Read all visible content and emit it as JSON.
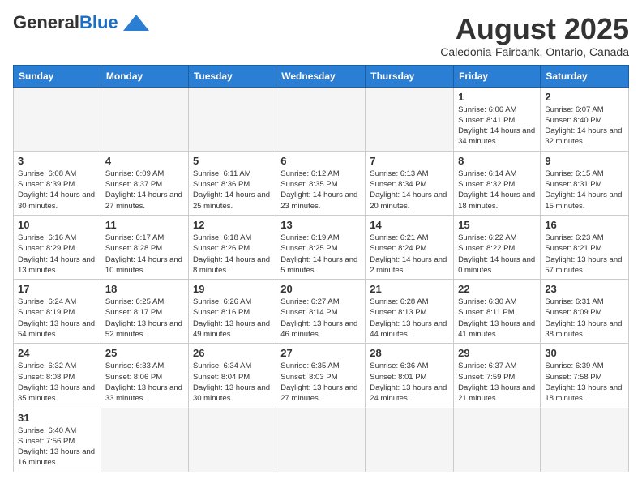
{
  "logo": {
    "general": "General",
    "blue": "Blue"
  },
  "title": "August 2025",
  "subtitle": "Caledonia-Fairbank, Ontario, Canada",
  "days_of_week": [
    "Sunday",
    "Monday",
    "Tuesday",
    "Wednesday",
    "Thursday",
    "Friday",
    "Saturday"
  ],
  "weeks": [
    [
      {
        "day": "",
        "info": ""
      },
      {
        "day": "",
        "info": ""
      },
      {
        "day": "",
        "info": ""
      },
      {
        "day": "",
        "info": ""
      },
      {
        "day": "",
        "info": ""
      },
      {
        "day": "1",
        "info": "Sunrise: 6:06 AM\nSunset: 8:41 PM\nDaylight: 14 hours and 34 minutes."
      },
      {
        "day": "2",
        "info": "Sunrise: 6:07 AM\nSunset: 8:40 PM\nDaylight: 14 hours and 32 minutes."
      }
    ],
    [
      {
        "day": "3",
        "info": "Sunrise: 6:08 AM\nSunset: 8:39 PM\nDaylight: 14 hours and 30 minutes."
      },
      {
        "day": "4",
        "info": "Sunrise: 6:09 AM\nSunset: 8:37 PM\nDaylight: 14 hours and 27 minutes."
      },
      {
        "day": "5",
        "info": "Sunrise: 6:11 AM\nSunset: 8:36 PM\nDaylight: 14 hours and 25 minutes."
      },
      {
        "day": "6",
        "info": "Sunrise: 6:12 AM\nSunset: 8:35 PM\nDaylight: 14 hours and 23 minutes."
      },
      {
        "day": "7",
        "info": "Sunrise: 6:13 AM\nSunset: 8:34 PM\nDaylight: 14 hours and 20 minutes."
      },
      {
        "day": "8",
        "info": "Sunrise: 6:14 AM\nSunset: 8:32 PM\nDaylight: 14 hours and 18 minutes."
      },
      {
        "day": "9",
        "info": "Sunrise: 6:15 AM\nSunset: 8:31 PM\nDaylight: 14 hours and 15 minutes."
      }
    ],
    [
      {
        "day": "10",
        "info": "Sunrise: 6:16 AM\nSunset: 8:29 PM\nDaylight: 14 hours and 13 minutes."
      },
      {
        "day": "11",
        "info": "Sunrise: 6:17 AM\nSunset: 8:28 PM\nDaylight: 14 hours and 10 minutes."
      },
      {
        "day": "12",
        "info": "Sunrise: 6:18 AM\nSunset: 8:26 PM\nDaylight: 14 hours and 8 minutes."
      },
      {
        "day": "13",
        "info": "Sunrise: 6:19 AM\nSunset: 8:25 PM\nDaylight: 14 hours and 5 minutes."
      },
      {
        "day": "14",
        "info": "Sunrise: 6:21 AM\nSunset: 8:24 PM\nDaylight: 14 hours and 2 minutes."
      },
      {
        "day": "15",
        "info": "Sunrise: 6:22 AM\nSunset: 8:22 PM\nDaylight: 14 hours and 0 minutes."
      },
      {
        "day": "16",
        "info": "Sunrise: 6:23 AM\nSunset: 8:21 PM\nDaylight: 13 hours and 57 minutes."
      }
    ],
    [
      {
        "day": "17",
        "info": "Sunrise: 6:24 AM\nSunset: 8:19 PM\nDaylight: 13 hours and 54 minutes."
      },
      {
        "day": "18",
        "info": "Sunrise: 6:25 AM\nSunset: 8:17 PM\nDaylight: 13 hours and 52 minutes."
      },
      {
        "day": "19",
        "info": "Sunrise: 6:26 AM\nSunset: 8:16 PM\nDaylight: 13 hours and 49 minutes."
      },
      {
        "day": "20",
        "info": "Sunrise: 6:27 AM\nSunset: 8:14 PM\nDaylight: 13 hours and 46 minutes."
      },
      {
        "day": "21",
        "info": "Sunrise: 6:28 AM\nSunset: 8:13 PM\nDaylight: 13 hours and 44 minutes."
      },
      {
        "day": "22",
        "info": "Sunrise: 6:30 AM\nSunset: 8:11 PM\nDaylight: 13 hours and 41 minutes."
      },
      {
        "day": "23",
        "info": "Sunrise: 6:31 AM\nSunset: 8:09 PM\nDaylight: 13 hours and 38 minutes."
      }
    ],
    [
      {
        "day": "24",
        "info": "Sunrise: 6:32 AM\nSunset: 8:08 PM\nDaylight: 13 hours and 35 minutes."
      },
      {
        "day": "25",
        "info": "Sunrise: 6:33 AM\nSunset: 8:06 PM\nDaylight: 13 hours and 33 minutes."
      },
      {
        "day": "26",
        "info": "Sunrise: 6:34 AM\nSunset: 8:04 PM\nDaylight: 13 hours and 30 minutes."
      },
      {
        "day": "27",
        "info": "Sunrise: 6:35 AM\nSunset: 8:03 PM\nDaylight: 13 hours and 27 minutes."
      },
      {
        "day": "28",
        "info": "Sunrise: 6:36 AM\nSunset: 8:01 PM\nDaylight: 13 hours and 24 minutes."
      },
      {
        "day": "29",
        "info": "Sunrise: 6:37 AM\nSunset: 7:59 PM\nDaylight: 13 hours and 21 minutes."
      },
      {
        "day": "30",
        "info": "Sunrise: 6:39 AM\nSunset: 7:58 PM\nDaylight: 13 hours and 18 minutes."
      }
    ],
    [
      {
        "day": "31",
        "info": "Sunrise: 6:40 AM\nSunset: 7:56 PM\nDaylight: 13 hours and 16 minutes."
      },
      {
        "day": "",
        "info": ""
      },
      {
        "day": "",
        "info": ""
      },
      {
        "day": "",
        "info": ""
      },
      {
        "day": "",
        "info": ""
      },
      {
        "day": "",
        "info": ""
      },
      {
        "day": "",
        "info": ""
      }
    ]
  ]
}
